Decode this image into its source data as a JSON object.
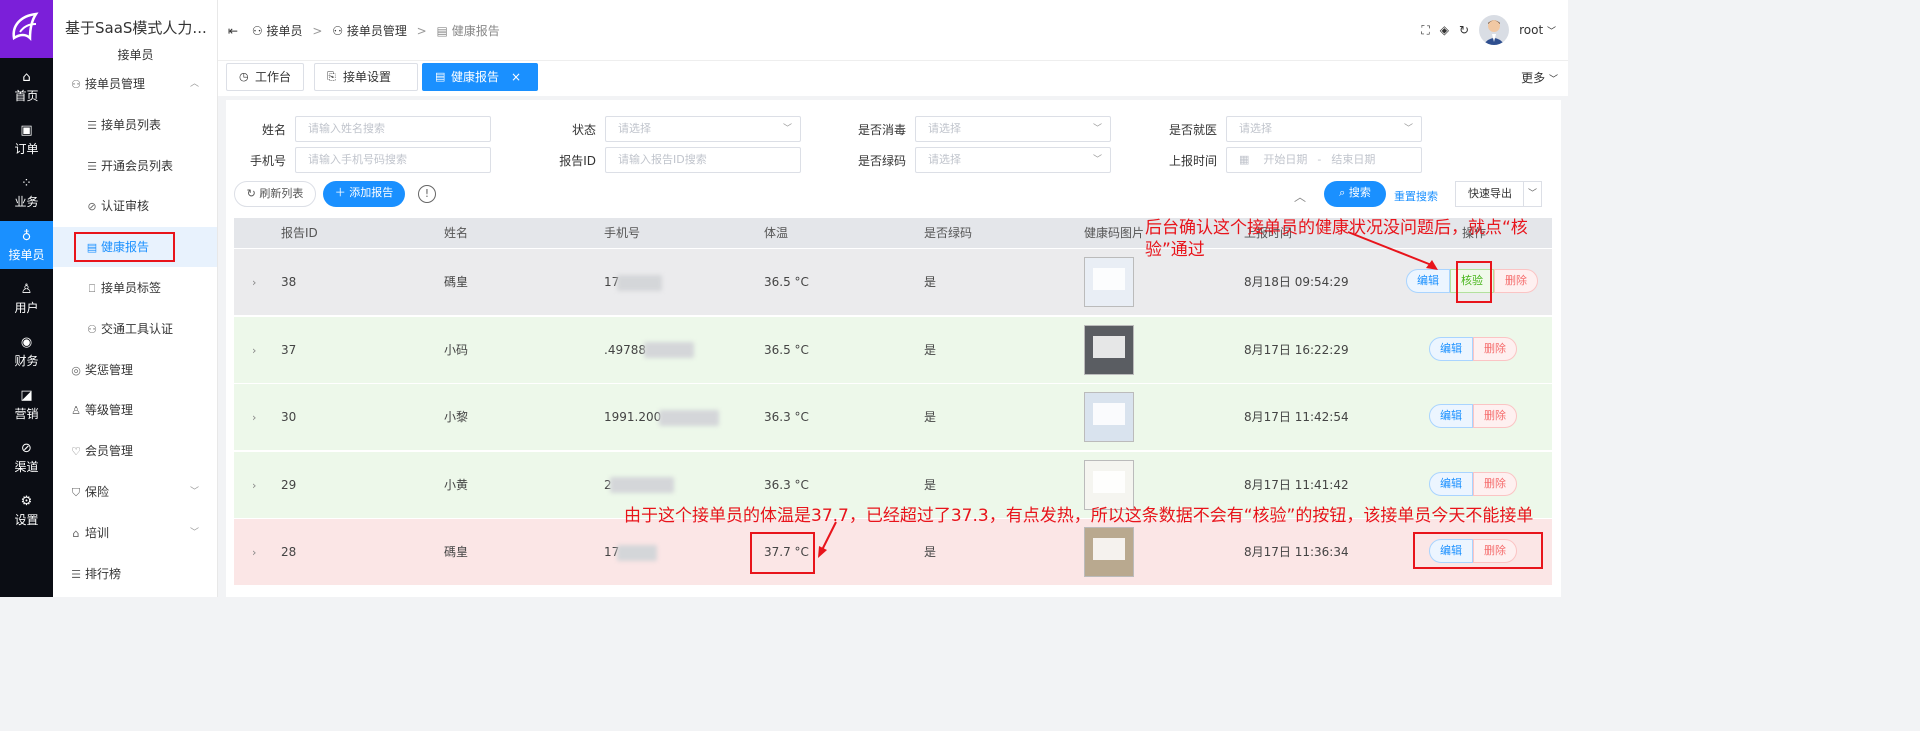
{
  "app": {
    "title": "基于SaaS模式人力...",
    "subtitle": "接单员"
  },
  "rail": [
    {
      "icon": "home-icon",
      "glyph": "⌂",
      "label": "首页"
    },
    {
      "icon": "order-icon",
      "glyph": "▣",
      "label": "订单"
    },
    {
      "icon": "business-icon",
      "glyph": "⁘",
      "label": "业务"
    },
    {
      "icon": "courier-icon",
      "glyph": "♁",
      "label": "接单员"
    },
    {
      "icon": "user-icon",
      "glyph": "♙",
      "label": "用户"
    },
    {
      "icon": "finance-icon",
      "glyph": "◉",
      "label": "财务"
    },
    {
      "icon": "marketing-icon",
      "glyph": "◪",
      "label": "营销"
    },
    {
      "icon": "channel-icon",
      "glyph": "⊘",
      "label": "渠道"
    },
    {
      "icon": "settings-icon",
      "glyph": "⚙",
      "label": "设置"
    }
  ],
  "menu": [
    {
      "label": "接单员管理",
      "icon": "⚇",
      "level": 1,
      "arrow": "︿"
    },
    {
      "label": "接单员列表",
      "icon": "☰",
      "level": 2
    },
    {
      "label": "开通会员列表",
      "icon": "☰",
      "level": 2
    },
    {
      "label": "认证审核",
      "icon": "⊘",
      "level": 2
    },
    {
      "label": "健康报告",
      "icon": "▤",
      "level": 2,
      "active": true
    },
    {
      "label": "接单员标签",
      "icon": "⎕",
      "level": 2
    },
    {
      "label": "交通工具认证",
      "icon": "⚇",
      "level": 2
    },
    {
      "label": "奖惩管理",
      "icon": "◎",
      "level": 1
    },
    {
      "label": "等级管理",
      "icon": "♙",
      "level": 1
    },
    {
      "label": "会员管理",
      "icon": "♡",
      "level": 1
    },
    {
      "label": "保险",
      "icon": "⛉",
      "level": 1,
      "arrow": "﹀"
    },
    {
      "label": "培训",
      "icon": "⌂",
      "level": 1,
      "arrow": "﹀"
    },
    {
      "label": "排行榜",
      "icon": "☰",
      "level": 1
    }
  ],
  "breadcrumb": [
    "接单员",
    "接单员管理",
    "健康报告"
  ],
  "header": {
    "user": "root"
  },
  "tabs": [
    {
      "label": "工作台",
      "icon": "◷"
    },
    {
      "label": "接单设置",
      "icon": "⎘"
    },
    {
      "label": "健康报告",
      "icon": "▤",
      "active": true
    }
  ],
  "tabs_more": "更多",
  "filters": {
    "name": {
      "label": "姓名",
      "placeholder": "请输入姓名搜索"
    },
    "status": {
      "label": "状态",
      "placeholder": "请选择"
    },
    "disinfect": {
      "label": "是否消毒",
      "placeholder": "请选择"
    },
    "doctor": {
      "label": "是否就医",
      "placeholder": "请选择"
    },
    "phone": {
      "label": "手机号",
      "placeholder": "请输入手机号码搜索"
    },
    "report_id": {
      "label": "报告ID",
      "placeholder": "请输入报告ID搜索"
    },
    "green_code": {
      "label": "是否绿码",
      "placeholder": "请选择"
    },
    "report_time": {
      "label": "上报时间",
      "start": "开始日期",
      "end": "结束日期",
      "sep": "-"
    }
  },
  "toolbar": {
    "refresh": "刷新列表",
    "add": "添加报告",
    "search": "搜索",
    "reset": "重置搜索",
    "export": "快速导出"
  },
  "table": {
    "headers": [
      "报告ID",
      "姓名",
      "手机号",
      "体温",
      "是否绿码",
      "健康码图片",
      "上报时间",
      "操作"
    ],
    "rows": [
      {
        "id": "38",
        "name": "碼皇",
        "phone": "17",
        "temp": "36.5 °C",
        "green": "是",
        "time": "8月18日 09:54:29",
        "ops": [
          "编辑",
          "核验",
          "删除"
        ],
        "bg": "#ebebed"
      },
      {
        "id": "37",
        "name": "小码",
        "phone": ".49788",
        "temp": "36.5 °C",
        "green": "是",
        "time": "8月17日 16:22:29",
        "ops": [
          "编辑",
          "删除"
        ],
        "bg": "#edf8ea"
      },
      {
        "id": "30",
        "name": "小黎",
        "phone": "1991.200",
        "temp": "36.3 °C",
        "green": "是",
        "time": "8月17日 11:42:54",
        "ops": [
          "编辑",
          "删除"
        ],
        "bg": "#edf8ea"
      },
      {
        "id": "29",
        "name": "小黄",
        "phone": "2",
        "temp": "36.3 °C",
        "green": "是",
        "time": "8月17日 11:41:42",
        "ops": [
          "编辑",
          "删除"
        ],
        "bg": "#edf8ea"
      },
      {
        "id": "28",
        "name": "碼皇",
        "phone": "17",
        "temp": "37.7 °C",
        "green": "是",
        "time": "8月17日 11:36:34",
        "ops": [
          "编辑",
          "删除"
        ],
        "bg": "#fbe6e6"
      }
    ]
  },
  "annotations": {
    "top_line1": "后台确认这个接单员的健康状况没问题后，就点“核",
    "top_line2": "验”通过",
    "bottom": "由于这个接单员的体温是37.7，已经超过了37.3，有点发热，所以这条数据不会有“核验”的按钮，该接单员今天不能接单"
  },
  "colors": {
    "primary": "#1a90ff",
    "danger": "#e8141b",
    "rail": "#0b0d14",
    "logo": "#7b1fd9"
  }
}
